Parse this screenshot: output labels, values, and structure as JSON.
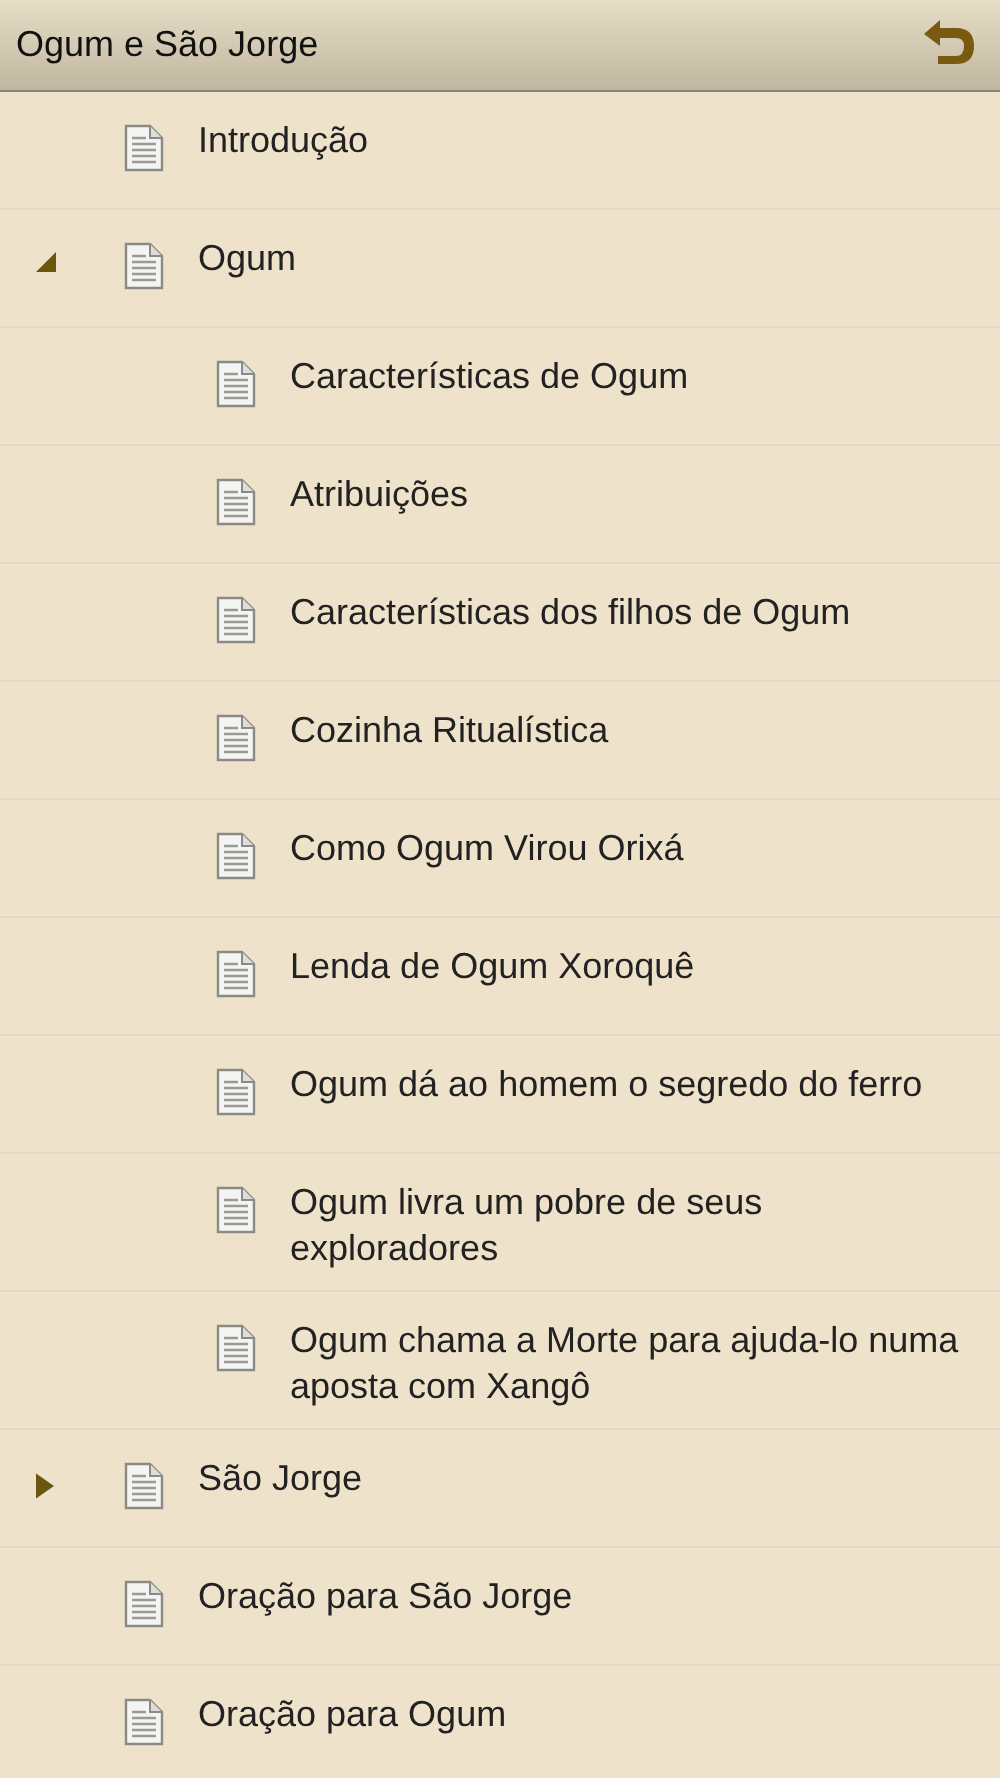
{
  "header": {
    "title": "Ogum e São Jorge"
  },
  "tree": [
    {
      "label": "Introdução"
    },
    {
      "label": "Ogum",
      "expanded": true,
      "children": [
        {
          "label": "Características de Ogum"
        },
        {
          "label": "Atribuições"
        },
        {
          "label": "Características dos filhos de Ogum"
        },
        {
          "label": "Cozinha Ritualística"
        },
        {
          "label": "Como Ogum Virou Orixá"
        },
        {
          "label": "Lenda de Ogum Xoroquê"
        },
        {
          "label": "Ogum dá ao homem o segredo do ferro"
        },
        {
          "label": "Ogum livra um pobre de seus exploradores"
        },
        {
          "label": "Ogum chama a Morte para ajuda-lo numa aposta com Xangô"
        }
      ]
    },
    {
      "label": "São Jorge",
      "expanded": false
    },
    {
      "label": "Oração para São Jorge"
    },
    {
      "label": "Oração para Ogum"
    }
  ]
}
